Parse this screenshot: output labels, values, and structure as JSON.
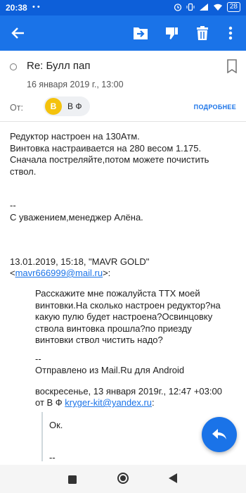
{
  "status_bar": {
    "time": "20:38",
    "battery": "28"
  },
  "app_bar": {
    "icons": [
      "back-arrow-icon",
      "move-to-folder-icon",
      "thumbs-down-icon",
      "trash-icon",
      "more-vert-icon"
    ]
  },
  "message": {
    "subject": "Re: Булл пап",
    "date": "16 января 2019 г., 13:00",
    "from_label": "От:",
    "sender_initial": "В",
    "sender_name": "В Ф",
    "details_link": "ПОДРОБНЕЕ"
  },
  "body": {
    "lines": [
      "Редуктор настроен на 130Атм.",
      "Винтовка настраивается на 280 весом 1.175.",
      "Сначала постреляйте,потом можете почистить",
      "ствол."
    ],
    "sig_dash": "--",
    "signature": "С уважением,менеджер Алёна.",
    "quote_header_1": "13.01.2019, 15:18, \"MAVR GOLD\"",
    "quote_header_2_prefix": "<",
    "quote_header_2_email": "mavr666999@mail.ru",
    "quote_header_2_suffix": ">:"
  },
  "quoted": {
    "lines": [
      "Расскажите мне пожалуйста ТТХ моей",
      "винтовки.На сколько настроен редуктор?на",
      "какую пулю будет настроена?Освинцовку",
      "ствола винтовка прошла?по приезду",
      "винтовки ствол чистить надо?"
    ],
    "sig_dash": "--",
    "sent_from": "Отправлено из Mail.Ru для Android",
    "reply_header_1": "воскресенье, 13 января 2019г., 12:47 +03:00",
    "reply_header_2_prefix": "от В Ф ",
    "reply_header_2_email": "kryger-kit@yandex.ru",
    "reply_header_2_suffix": ":",
    "nested_ok": "Ок.",
    "nested_dash": "--"
  },
  "colors": {
    "primary": "#1a73e8",
    "status_bar": "#0d5fd9",
    "avatar": "#f4c20d"
  }
}
